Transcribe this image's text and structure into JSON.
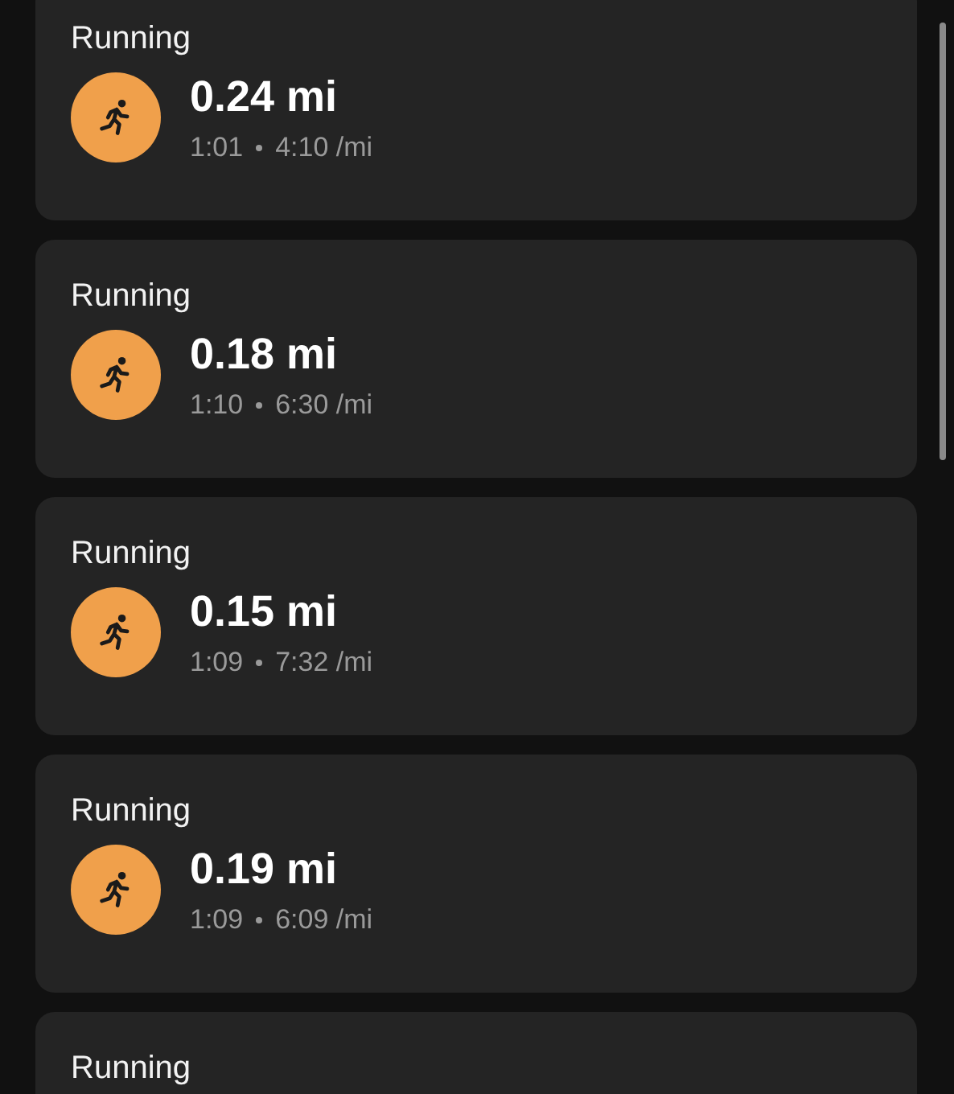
{
  "activities": [
    {
      "kind": "full",
      "type": "Running",
      "distance": "0.24 mi",
      "duration": "1:01",
      "pace": "4:10 /mi"
    },
    {
      "kind": "full",
      "type": "Running",
      "distance": "0.18 mi",
      "duration": "1:10",
      "pace": "6:30 /mi"
    },
    {
      "kind": "full",
      "type": "Running",
      "distance": "0.15 mi",
      "duration": "1:09",
      "pace": "7:32 /mi"
    },
    {
      "kind": "full",
      "type": "Running",
      "distance": "0.19 mi",
      "duration": "1:09",
      "pace": "6:09 /mi"
    },
    {
      "kind": "partial",
      "type": "Running"
    }
  ]
}
